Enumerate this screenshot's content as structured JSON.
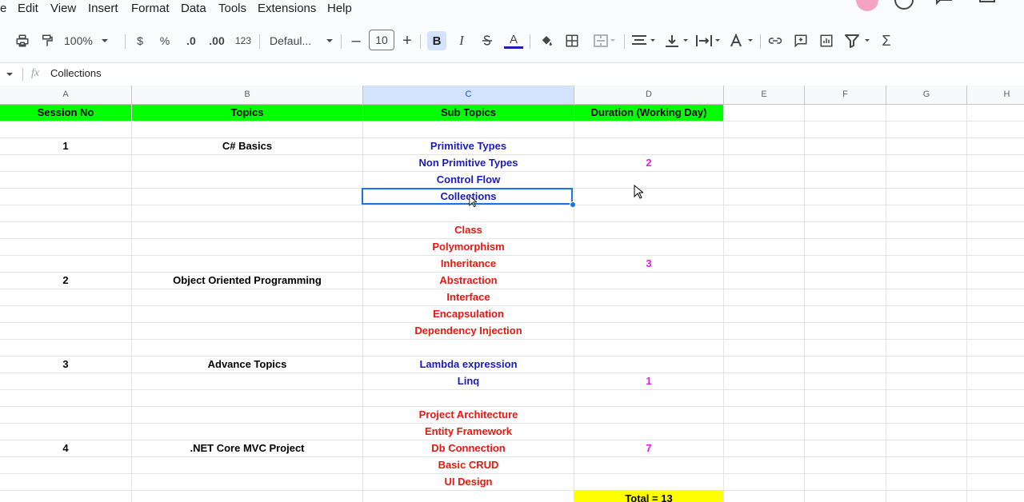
{
  "menu": [
    "e",
    "Edit",
    "View",
    "Insert",
    "Format",
    "Data",
    "Tools",
    "Extensions",
    "Help"
  ],
  "toolbar": {
    "zoom": "100%",
    "currency": "$",
    "percent": "%",
    "decrease_decimal": ".0",
    "increase_decimal": ".00",
    "number_format": "123",
    "font": "Defaul...",
    "font_size": "10",
    "bold": "B",
    "italic": "I",
    "text_color_letter": "A"
  },
  "formula_bar": {
    "fx": "fx",
    "value": "Collections"
  },
  "columns": [
    "A",
    "B",
    "C",
    "D",
    "E",
    "F",
    "G",
    "H"
  ],
  "selected_column": "C",
  "selected_cell": "C6",
  "colors": {
    "header_bg": "#00ff00",
    "blue_text": "#1c1cbc",
    "red_text": "#e8170f",
    "magenta_text": "#e619e6",
    "total_bg": "#ffff00",
    "selection": "#1a73e8"
  },
  "rows": [
    {
      "a": "Session No",
      "b": "Topics",
      "c": "Sub Topics",
      "d": "Duration (Working Day)"
    },
    {
      "a": "",
      "b": "",
      "c": "",
      "d": ""
    },
    {
      "a": "1",
      "b": "C# Basics",
      "c": "Primitive Types",
      "d": ""
    },
    {
      "a": "",
      "b": "",
      "c": "Non Primitive Types",
      "d": "2"
    },
    {
      "a": "",
      "b": "",
      "c": "Control Flow",
      "d": ""
    },
    {
      "a": "",
      "b": "",
      "c": "Collections",
      "d": ""
    },
    {
      "a": "",
      "b": "",
      "c": "",
      "d": ""
    },
    {
      "a": "",
      "b": "",
      "c": "Class",
      "d": ""
    },
    {
      "a": "",
      "b": "",
      "c": "Polymorphism",
      "d": ""
    },
    {
      "a": "",
      "b": "",
      "c": "Inheritance",
      "d": "3"
    },
    {
      "a": "2",
      "b": "Object Oriented Programming",
      "c": "Abstraction",
      "d": ""
    },
    {
      "a": "",
      "b": "",
      "c": "Interface",
      "d": ""
    },
    {
      "a": "",
      "b": "",
      "c": "Encapsulation",
      "d": ""
    },
    {
      "a": "",
      "b": "",
      "c": "Dependency Injection",
      "d": ""
    },
    {
      "a": "",
      "b": "",
      "c": "",
      "d": ""
    },
    {
      "a": "3",
      "b": "Advance Topics",
      "c": "Lambda expression",
      "d": ""
    },
    {
      "a": "",
      "b": "",
      "c": "Linq",
      "d": "1"
    },
    {
      "a": "",
      "b": "",
      "c": "",
      "d": ""
    },
    {
      "a": "",
      "b": "",
      "c": "Project Architecture",
      "d": ""
    },
    {
      "a": "",
      "b": "",
      "c": "Entity Framework",
      "d": ""
    },
    {
      "a": "4",
      "b": ".NET Core MVC Project",
      "c": "Db Connection",
      "d": "7"
    },
    {
      "a": "",
      "b": "",
      "c": "Basic CRUD",
      "d": ""
    },
    {
      "a": "",
      "b": "",
      "c": "UI Design",
      "d": ""
    },
    {
      "a": "",
      "b": "",
      "c": "",
      "d": "Total = 13"
    }
  ]
}
